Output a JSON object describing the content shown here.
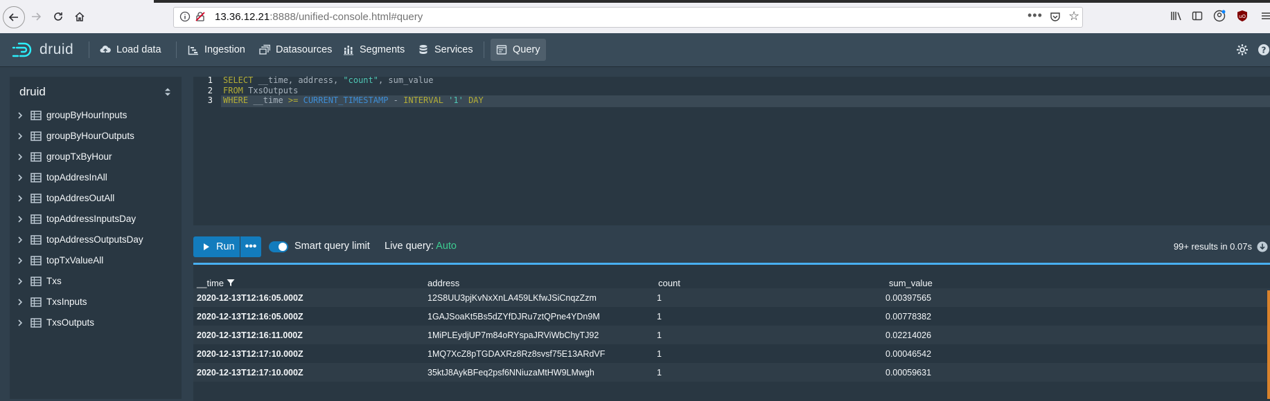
{
  "browser": {
    "url_host": "13.36.12.21",
    "url_rest": ":8888/unified-console.html#query",
    "icons": [
      "back-arrow-icon",
      "forward-arrow-icon",
      "reload-icon",
      "home-icon",
      "info-icon",
      "insecure-lock-icon",
      "page-actions-icon",
      "pocket-icon",
      "bookmark-star-icon",
      "library-icon",
      "sidebar-icon",
      "account-icon",
      "ublock-icon",
      "menu-icon"
    ]
  },
  "header": {
    "logo_text": "druid",
    "nav": [
      {
        "label": "Load data",
        "icon": "cloud-upload-icon"
      },
      {
        "label": "Ingestion",
        "icon": "gantt-chart-icon"
      },
      {
        "label": "Datasources",
        "icon": "multi-select-icon"
      },
      {
        "label": "Segments",
        "icon": "stacked-chart-icon"
      },
      {
        "label": "Services",
        "icon": "database-icon"
      },
      {
        "label": "Query",
        "icon": "application-icon",
        "active": true
      }
    ],
    "right_icons": [
      "gear-icon",
      "help-icon"
    ]
  },
  "sidebar": {
    "schema": "druid",
    "tables": [
      "groupByHourInputs",
      "groupByHourOutputs",
      "groupTxByHour",
      "topAddresInAll",
      "topAddresOutAll",
      "topAddressInputsDay",
      "topAddressOutputsDay",
      "topTxValueAll",
      "Txs",
      "TxsInputs",
      "TxsOutputs"
    ]
  },
  "editor": {
    "line_numbers": [
      "1",
      "2",
      "3"
    ],
    "lines": [
      [
        {
          "t": "SELECT",
          "c": "kw"
        },
        {
          "t": " __time, address, ",
          "c": "id"
        },
        {
          "t": "\"count\"",
          "c": "str"
        },
        {
          "t": ", sum_value",
          "c": "id"
        }
      ],
      [
        {
          "t": "FROM",
          "c": "kw"
        },
        {
          "t": " TxsOutputs",
          "c": "id"
        }
      ],
      [
        {
          "t": "WHERE",
          "c": "kw"
        },
        {
          "t": " __time ",
          "c": "id"
        },
        {
          "t": ">=",
          "c": "kw"
        },
        {
          "t": " ",
          "c": "id"
        },
        {
          "t": "CURRENT_TIMESTAMP",
          "c": "fn"
        },
        {
          "t": " - ",
          "c": "id"
        },
        {
          "t": "INTERVAL",
          "c": "kw"
        },
        {
          "t": " ",
          "c": "id"
        },
        {
          "t": "'1'",
          "c": "str"
        },
        {
          "t": " ",
          "c": "id"
        },
        {
          "t": "DAY",
          "c": "kw"
        }
      ]
    ]
  },
  "runbar": {
    "run_label": "Run",
    "more_label": "•••",
    "smart_limit_label": "Smart query limit",
    "smart_limit_on": true,
    "live_query_label": "Live query: ",
    "live_query_value": "Auto",
    "results_info": "99+ results in 0.07s"
  },
  "table": {
    "columns": [
      "__time",
      "address",
      "count",
      "sum_value"
    ],
    "rows": [
      [
        "2020-12-13T12:16:05.000Z",
        "12S8UU3pjKvNxXnLA459LKfwJSiCnqzZzm",
        "1",
        "0.00397565"
      ],
      [
        "2020-12-13T12:16:05.000Z",
        "1GAJSoaKt5Bs5dZYfDJRu7ztQPne4YDn9M",
        "1",
        "0.00778382"
      ],
      [
        "2020-12-13T12:16:11.000Z",
        "1MiPLEydjUP7m84oRYspaJRViWbChyTJ92",
        "1",
        "0.02214026"
      ],
      [
        "2020-12-13T12:17:10.000Z",
        "1MQ7XcZ8pTGDAXRz8Rz8svsf75E13ARdVF",
        "1",
        "0.00046542"
      ],
      [
        "2020-12-13T12:17:10.000Z",
        "35ktJ8AykBFeq2psf6NNiuzaMtHW9LMwgh",
        "1",
        "0.00059631"
      ]
    ]
  },
  "colors": {
    "accent": "#137cbd",
    "live_auto": "#3dcc91",
    "keyword": "#b4ae36",
    "string": "#50c8b6",
    "function": "#3e8ed6"
  }
}
